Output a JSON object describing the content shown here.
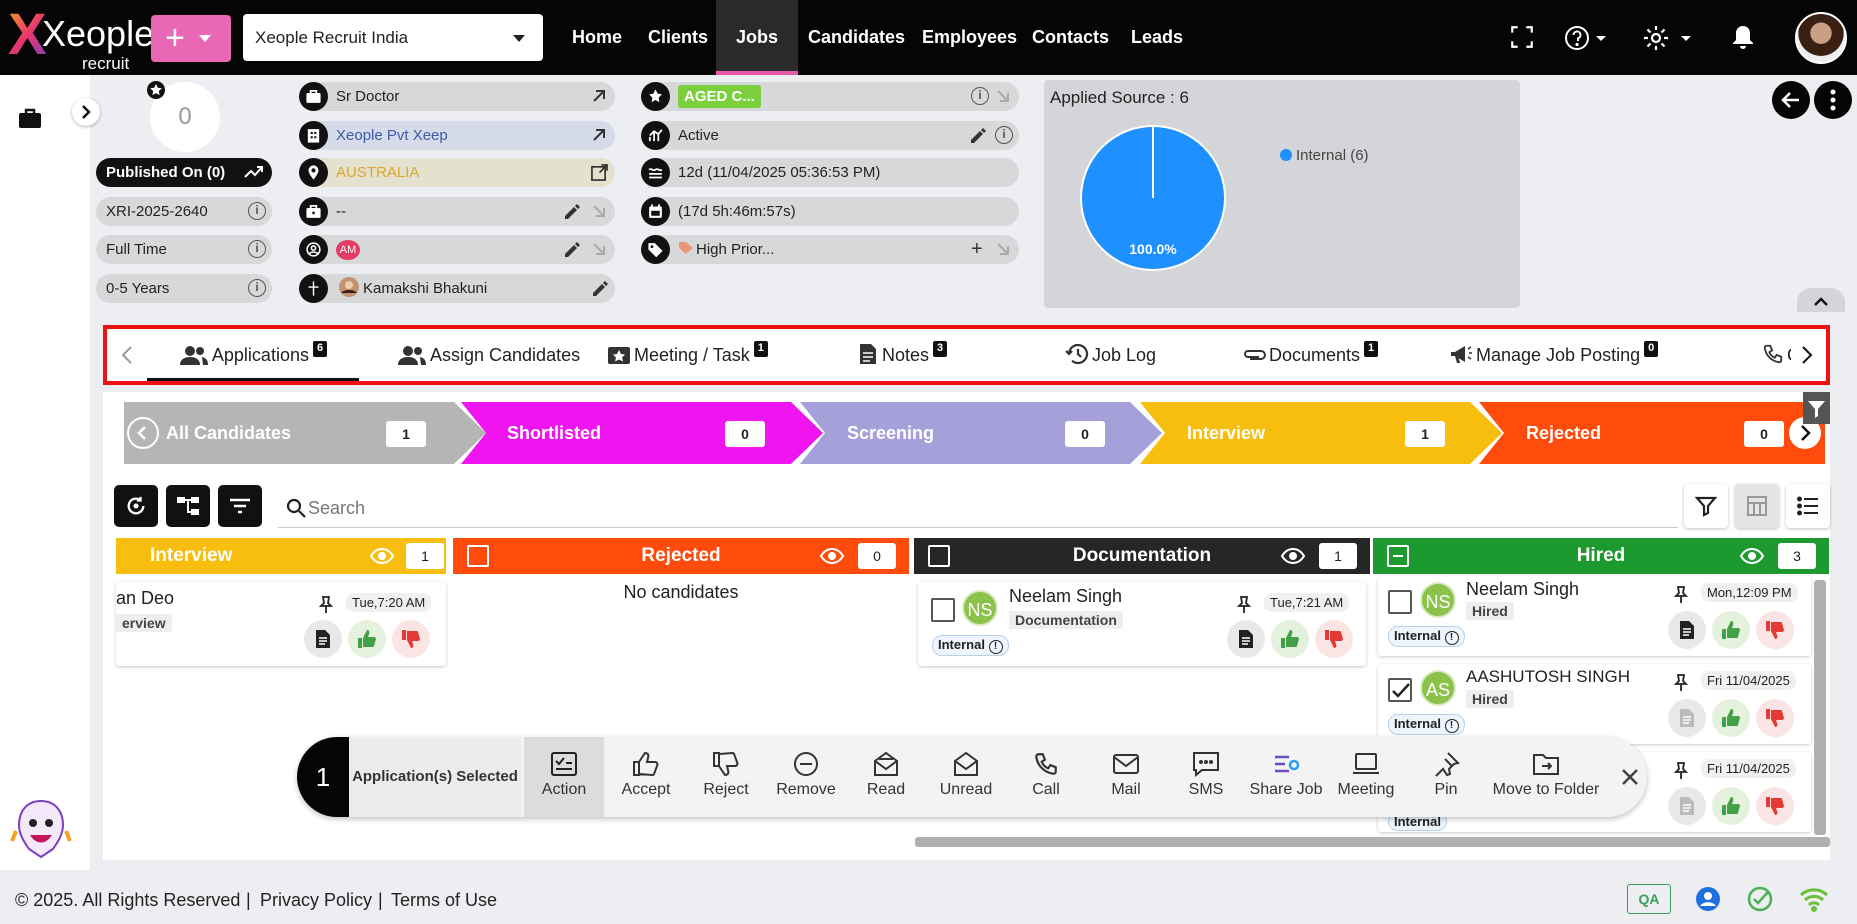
{
  "app": {
    "logo_main": "Xeople",
    "logo_sub": "recruit",
    "add_symbol": "+"
  },
  "org_selector": {
    "value": "Xeople Recruit India"
  },
  "nav": {
    "items": [
      "Home",
      "Clients",
      "Jobs",
      "Candidates",
      "Employees",
      "Contacts",
      "Leads"
    ],
    "active": "Jobs"
  },
  "job": {
    "score": "0",
    "published": "Published On (0)",
    "code": "XRI-2025-2640",
    "type": "Full Time",
    "experience": "0-5 Years",
    "title": "Sr Doctor",
    "company": "Xeople Pvt Xeep",
    "location": "AUSTRALIA",
    "field4": "--",
    "owner_initials": "AM",
    "recruiter": "Kamakshi Bhakuni",
    "aged_badge": "AGED C...",
    "status": "Active",
    "age": "12d (11/04/2025 05:36:53 PM)",
    "duration": "(17d 5h:46m:57s)",
    "priority": "High Prior..."
  },
  "applied_source": {
    "title": "Applied Source : 6",
    "slices": [
      {
        "label": "Internal (6)",
        "value": 6,
        "pct_label": "100.0%",
        "color": "#1e90ff"
      }
    ]
  },
  "tabs": [
    {
      "label": "Applications",
      "badge": "6"
    },
    {
      "label": "Assign Candidates",
      "badge": ""
    },
    {
      "label": "Meeting / Task",
      "badge": "1"
    },
    {
      "label": "Notes",
      "badge": "3"
    },
    {
      "label": "Job Log",
      "badge": ""
    },
    {
      "label": "Documents",
      "badge": "1"
    },
    {
      "label": "Manage Job Posting",
      "badge": "0"
    },
    {
      "label": "C",
      "badge": ""
    }
  ],
  "stages": [
    {
      "label": "All Candidates",
      "count": "1",
      "color": "#b5b5b5"
    },
    {
      "label": "Shortlisted",
      "count": "0",
      "color": "#f015f0"
    },
    {
      "label": "Screening",
      "count": "0",
      "color": "#a6a0da"
    },
    {
      "label": "Interview",
      "count": "1",
      "color": "#f8be0e"
    },
    {
      "label": "Rejected",
      "count": "0",
      "color": "#ff4b0b"
    }
  ],
  "search": {
    "placeholder": "Search"
  },
  "columns": [
    {
      "title": "Interview",
      "count": "1",
      "color": "#f8be0e"
    },
    {
      "title": "Rejected",
      "count": "0",
      "color": "#ff4b0b",
      "empty": "No candidates"
    },
    {
      "title": "Documentation",
      "count": "1",
      "color": "#262626"
    },
    {
      "title": "Hired",
      "count": "3",
      "color": "#1d9a2f"
    }
  ],
  "cards": {
    "interview": {
      "name": "an Deo",
      "stage": "erview",
      "time": "Tue,7:20 AM"
    },
    "documentation": {
      "initials": "NS",
      "name": "Neelam Singh",
      "stage": "Documentation",
      "time": "Tue,7:21 AM",
      "source": "Internal"
    },
    "hired1": {
      "initials": "NS",
      "name": "Neelam Singh",
      "stage": "Hired",
      "time": "Mon,12:09 PM",
      "source": "Internal"
    },
    "hired2": {
      "initials": "AS",
      "name": "AASHUTOSH SINGH",
      "stage": "Hired",
      "time": "Fri 11/04/2025",
      "source": "Internal"
    },
    "hired3": {
      "time": "Fri 11/04/2025",
      "source": "Internal"
    }
  },
  "action_bar": {
    "selected_count": "1",
    "selected_label": "Application(s) Selected",
    "actions": [
      "Action",
      "Accept",
      "Reject",
      "Remove",
      "Read",
      "Unread",
      "Call",
      "Mail",
      "SMS",
      "Share Job",
      "Meeting",
      "Pin",
      "Move to Folder"
    ]
  },
  "footer": {
    "copyright": "© 2025. All Rights Reserved",
    "privacy": "Privacy Policy",
    "terms": "Terms of Use",
    "sep": "|",
    "env": "QA"
  }
}
